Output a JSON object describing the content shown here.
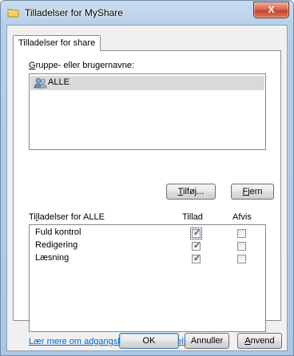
{
  "window": {
    "title": "Tilladelser for MyShare",
    "close_label": "X"
  },
  "tabs": [
    {
      "label": "Tilladelser for share",
      "selected": true
    }
  ],
  "groups": {
    "label_mnemonic": "G",
    "label_rest": "ruppe- eller brugernavne:",
    "items": [
      {
        "name": "ALLE",
        "icon": "users-icon",
        "selected": true
      }
    ],
    "add_mnemonic": "T",
    "add_rest": "ilføj...",
    "remove_mnemonic": "F",
    "remove_rest": "jern"
  },
  "permissions": {
    "label_prefix": "Ti",
    "label_mnemonic": "l",
    "label_rest": "ladelser for ALLE",
    "allow_header": "Tillad",
    "deny_header": "Afvis",
    "rows": [
      {
        "name": "Fuld kontrol",
        "allow": true,
        "deny": false
      },
      {
        "name": "Redigering",
        "allow": true,
        "deny": false
      },
      {
        "name": "Læsning",
        "allow": true,
        "deny": false
      }
    ]
  },
  "help_link": "Lær mere om adgangskontrol og tilladelser",
  "footer": {
    "ok": "OK",
    "cancel": "Annuller",
    "apply_mnemonic": "A",
    "apply_rest": "nvend"
  }
}
